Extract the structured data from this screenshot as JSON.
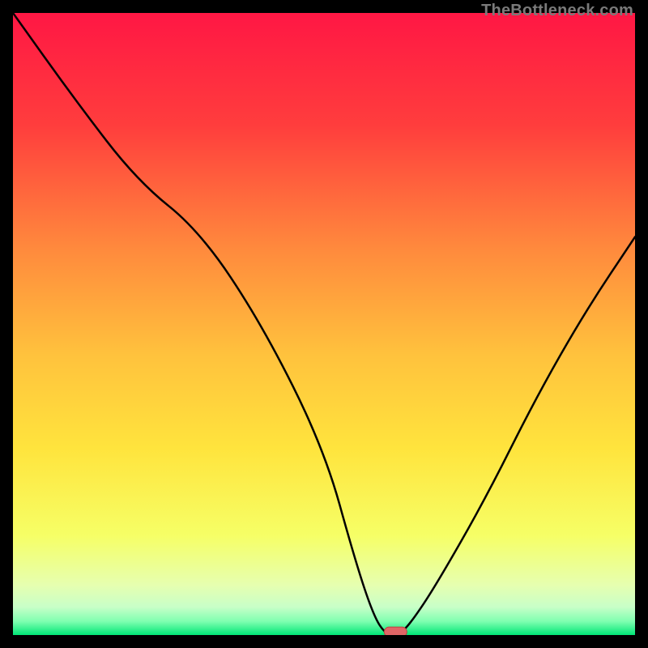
{
  "watermark": "TheBottleneck.com",
  "chart_data": {
    "type": "line",
    "title": "",
    "xlabel": "",
    "ylabel": "",
    "xlim": [
      0,
      100
    ],
    "ylim": [
      0,
      100
    ],
    "x": [
      0,
      10,
      20,
      30,
      40,
      50,
      55,
      58,
      60,
      62,
      64,
      68,
      76,
      84,
      92,
      100
    ],
    "values": [
      100,
      86,
      73,
      65,
      50,
      30,
      12,
      3,
      0,
      0,
      2,
      8,
      22,
      38,
      52,
      64
    ],
    "gradient_stops": [
      {
        "offset": 0.0,
        "color": "#ff1744"
      },
      {
        "offset": 0.18,
        "color": "#ff3d3d"
      },
      {
        "offset": 0.38,
        "color": "#ff8a3d"
      },
      {
        "offset": 0.55,
        "color": "#ffc23d"
      },
      {
        "offset": 0.7,
        "color": "#ffe43d"
      },
      {
        "offset": 0.84,
        "color": "#f6ff66"
      },
      {
        "offset": 0.92,
        "color": "#e6ffb0"
      },
      {
        "offset": 0.955,
        "color": "#c8ffc8"
      },
      {
        "offset": 0.978,
        "color": "#7fffb0"
      },
      {
        "offset": 1.0,
        "color": "#00e676"
      }
    ],
    "marker": {
      "x": 61.5,
      "y": 0.5,
      "color": "#e06666",
      "stroke": "#c04040"
    }
  }
}
